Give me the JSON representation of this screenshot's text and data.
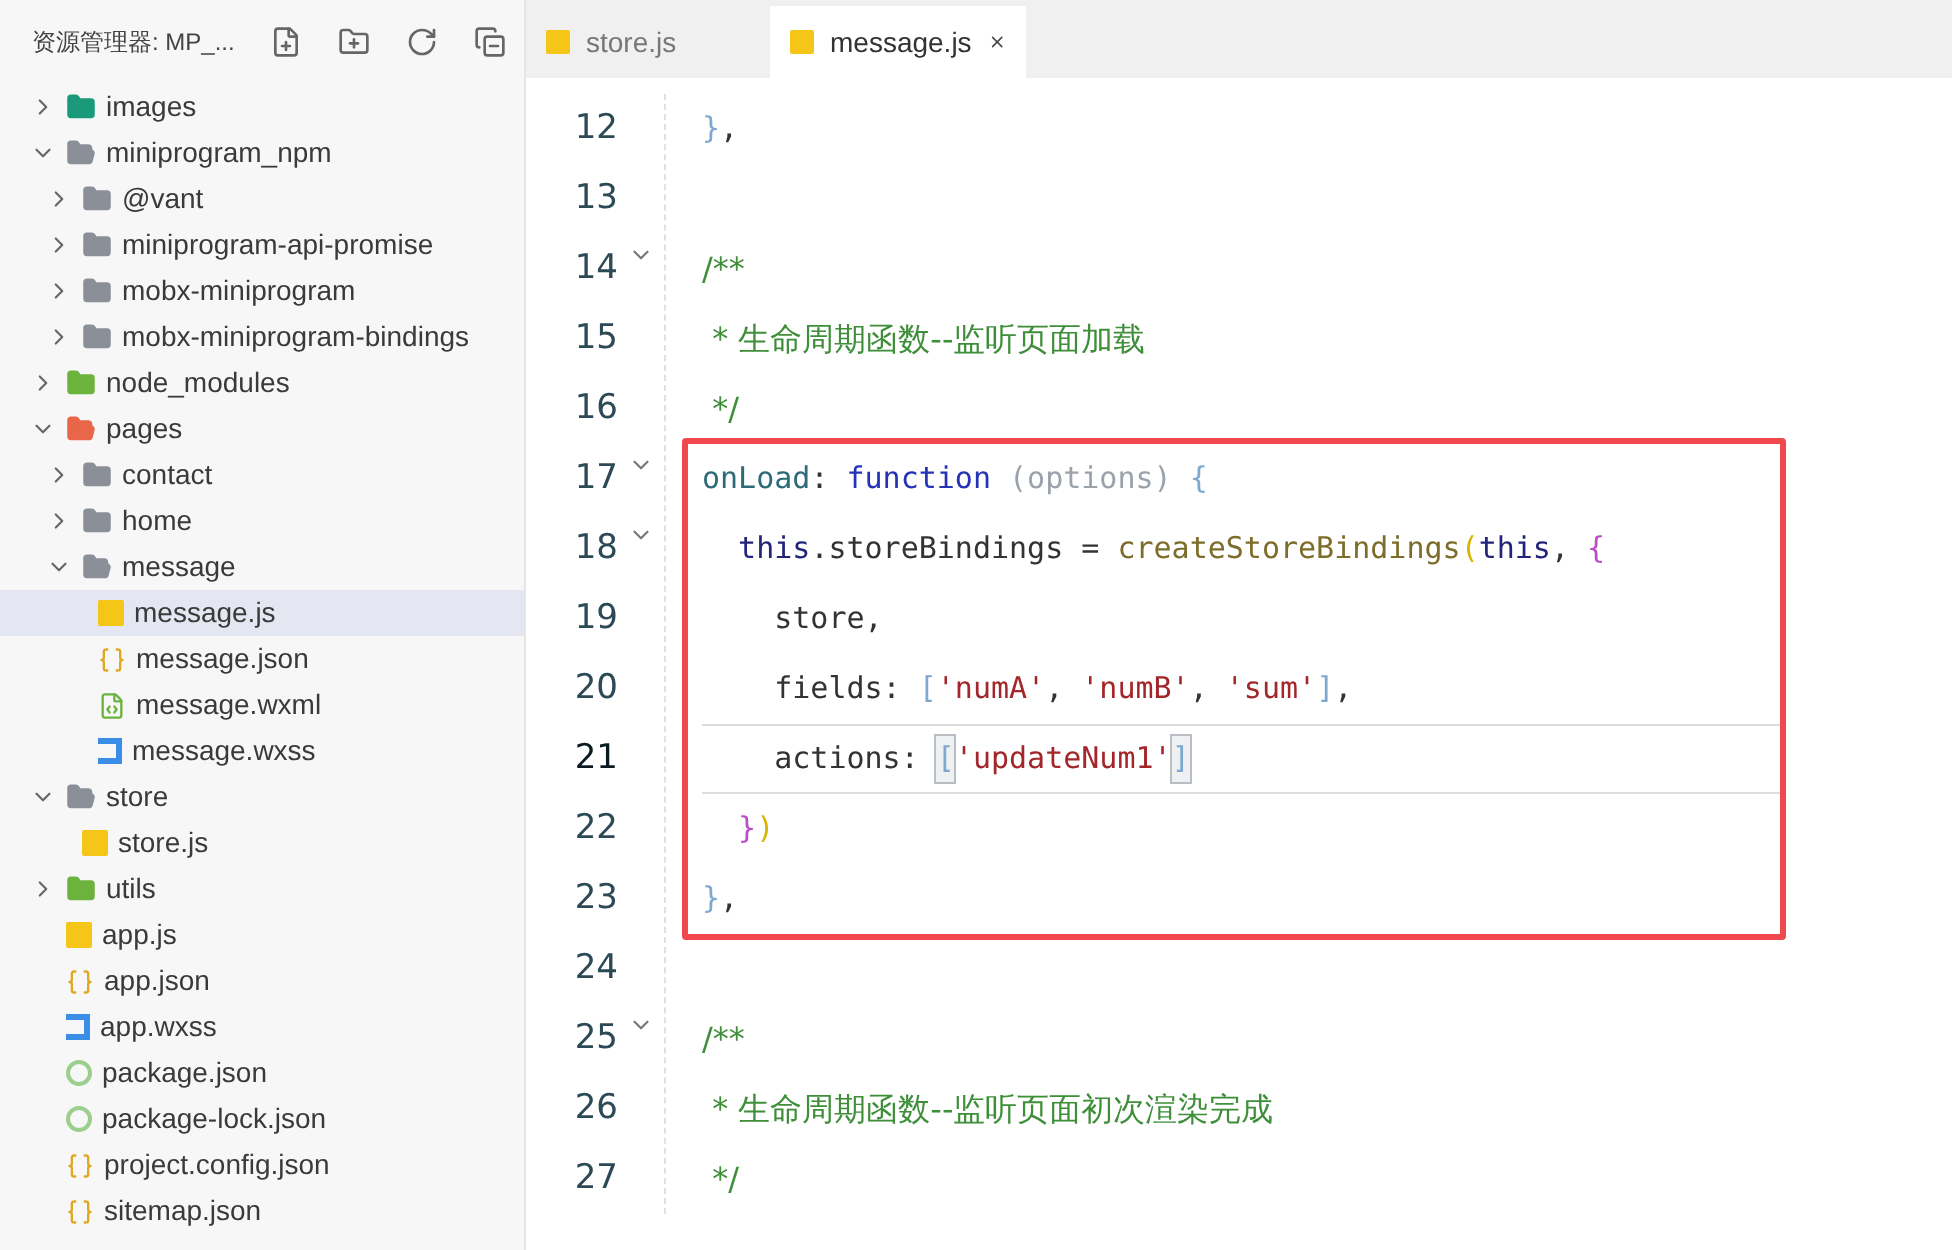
{
  "explorer": {
    "title": "资源管理器: MP_...",
    "tree": [
      {
        "name": "images",
        "kind": "folder",
        "color": "#1a9a7a",
        "expanded": false,
        "selected": false
      },
      {
        "name": "miniprogram_npm",
        "kind": "folder",
        "color": "#8a8f98",
        "expanded": true,
        "selected": false,
        "children": [
          {
            "name": "@vant",
            "kind": "folder",
            "color": "#8a8f98",
            "expanded": false,
            "selected": false
          },
          {
            "name": "miniprogram-api-promise",
            "kind": "folder",
            "color": "#8a8f98",
            "expanded": false,
            "selected": false
          },
          {
            "name": "mobx-miniprogram",
            "kind": "folder",
            "color": "#8a8f98",
            "expanded": false,
            "selected": false
          },
          {
            "name": "mobx-miniprogram-bindings",
            "kind": "folder",
            "color": "#8a8f98",
            "expanded": false,
            "selected": false
          }
        ]
      },
      {
        "name": "node_modules",
        "kind": "folder",
        "color": "#6cb33e",
        "expanded": false,
        "selected": false
      },
      {
        "name": "pages",
        "kind": "folder",
        "color": "#e8664a",
        "expanded": true,
        "selected": false,
        "children": [
          {
            "name": "contact",
            "kind": "folder",
            "color": "#8a8f98",
            "expanded": false,
            "selected": false
          },
          {
            "name": "home",
            "kind": "folder",
            "color": "#8a8f98",
            "expanded": false,
            "selected": false
          },
          {
            "name": "message",
            "kind": "folder",
            "color": "#8a8f98",
            "expanded": true,
            "selected": false,
            "children": [
              {
                "name": "message.js",
                "kind": "js",
                "selected": true
              },
              {
                "name": "message.json",
                "kind": "json",
                "selected": false
              },
              {
                "name": "message.wxml",
                "kind": "wxml",
                "selected": false
              },
              {
                "name": "message.wxss",
                "kind": "wxss",
                "selected": false
              }
            ]
          }
        ]
      },
      {
        "name": "store",
        "kind": "folder",
        "color": "#8a8f98",
        "expanded": true,
        "selected": false,
        "children": [
          {
            "name": "store.js",
            "kind": "js",
            "selected": false
          }
        ]
      },
      {
        "name": "utils",
        "kind": "folder",
        "color": "#6cb33e",
        "expanded": false,
        "selected": false
      },
      {
        "name": "app.js",
        "kind": "js",
        "selected": false
      },
      {
        "name": "app.json",
        "kind": "json",
        "selected": false
      },
      {
        "name": "app.wxss",
        "kind": "wxss",
        "selected": false
      },
      {
        "name": "package.json",
        "kind": "package",
        "selected": false
      },
      {
        "name": "package-lock.json",
        "kind": "package",
        "selected": false
      },
      {
        "name": "project.config.json",
        "kind": "json",
        "selected": false
      },
      {
        "name": "sitemap.json",
        "kind": "json",
        "selected": false
      }
    ]
  },
  "tabs": [
    {
      "label": "store.js",
      "selected": false
    },
    {
      "label": "message.js",
      "selected": true
    }
  ],
  "editor": {
    "blocks": [
      {
        "highlighted": false,
        "lines": [
          {
            "number": "12",
            "foldable": false,
            "current": false,
            "tokens": [
              {
                "kind": "brace",
                "text": "}"
              },
              {
                "kind": "plain",
                "text": ","
              }
            ]
          },
          {
            "number": "13",
            "foldable": false,
            "current": false
          },
          {
            "number": "14",
            "foldable": true,
            "current": false,
            "tokens": [
              {
                "kind": "comment",
                "text": "/**"
              }
            ]
          },
          {
            "number": "15",
            "foldable": false,
            "current": false,
            "tokens": [
              {
                "kind": "comment",
                "text": " * 生命周期函数--监听页面加载"
              }
            ]
          },
          {
            "number": "16",
            "foldable": false,
            "current": false,
            "tokens": [
              {
                "kind": "comment",
                "text": " */"
              }
            ]
          }
        ]
      },
      {
        "highlighted": true,
        "lines": [
          {
            "number": "17",
            "foldable": true,
            "current": false,
            "tokens": [
              {
                "kind": "key",
                "text": "onLoad"
              },
              {
                "kind": "plain",
                "text": ": "
              },
              {
                "kind": "keyword",
                "text": "function"
              },
              {
                "kind": "param",
                "text": " (options) "
              },
              {
                "kind": "brace",
                "text": "{"
              }
            ]
          },
          {
            "number": "18",
            "foldable": true,
            "current": false,
            "tokens": [
              {
                "kind": "self",
                "text": "  this"
              },
              {
                "kind": "plain",
                "text": ".storeBindings = "
              },
              {
                "kind": "func",
                "text": "createStoreBindings"
              },
              {
                "kind": "yellow",
                "text": "("
              },
              {
                "kind": "self",
                "text": "this"
              },
              {
                "kind": "plain",
                "text": ", "
              },
              {
                "kind": "purple",
                "text": "{"
              }
            ]
          },
          {
            "number": "19",
            "foldable": false,
            "current": false,
            "tokens": [
              {
                "kind": "plain",
                "text": "    store,"
              }
            ]
          },
          {
            "number": "20",
            "foldable": false,
            "current": false,
            "tokens": [
              {
                "kind": "plain",
                "text": "    fields: "
              },
              {
                "kind": "brace",
                "text": "["
              },
              {
                "kind": "string",
                "text": "'numA'"
              },
              {
                "kind": "plain",
                "text": ", "
              },
              {
                "kind": "string",
                "text": "'numB'"
              },
              {
                "kind": "plain",
                "text": ", "
              },
              {
                "kind": "string",
                "text": "'sum'"
              },
              {
                "kind": "brace",
                "text": "]"
              },
              {
                "kind": "plain",
                "text": ","
              }
            ]
          },
          {
            "number": "21",
            "foldable": false,
            "current": true,
            "tokens": [
              {
                "kind": "plain",
                "text": "    actions: "
              },
              {
                "kind": "matched",
                "text": "["
              },
              {
                "kind": "string",
                "text": "'updateNum1'"
              },
              {
                "kind": "matched",
                "text": "]"
              }
            ]
          },
          {
            "number": "22",
            "foldable": false,
            "current": false,
            "tokens": [
              {
                "kind": "purple",
                "text": "  }"
              },
              {
                "kind": "yellow",
                "text": ")"
              }
            ]
          },
          {
            "number": "23",
            "foldable": false,
            "current": false,
            "tokens": [
              {
                "kind": "brace",
                "text": "}"
              },
              {
                "kind": "plain",
                "text": ","
              }
            ]
          }
        ]
      },
      {
        "highlighted": false,
        "lines": [
          {
            "number": "24",
            "foldable": false,
            "current": false
          },
          {
            "number": "25",
            "foldable": true,
            "current": false,
            "tokens": [
              {
                "kind": "comment",
                "text": "/**"
              }
            ]
          },
          {
            "number": "26",
            "foldable": false,
            "current": false,
            "tokens": [
              {
                "kind": "comment",
                "text": " * 生命周期函数--监听页面初次渲染完成"
              }
            ]
          },
          {
            "number": "27",
            "foldable": false,
            "current": false,
            "tokens": [
              {
                "kind": "comment",
                "text": " */"
              }
            ]
          }
        ]
      }
    ]
  }
}
